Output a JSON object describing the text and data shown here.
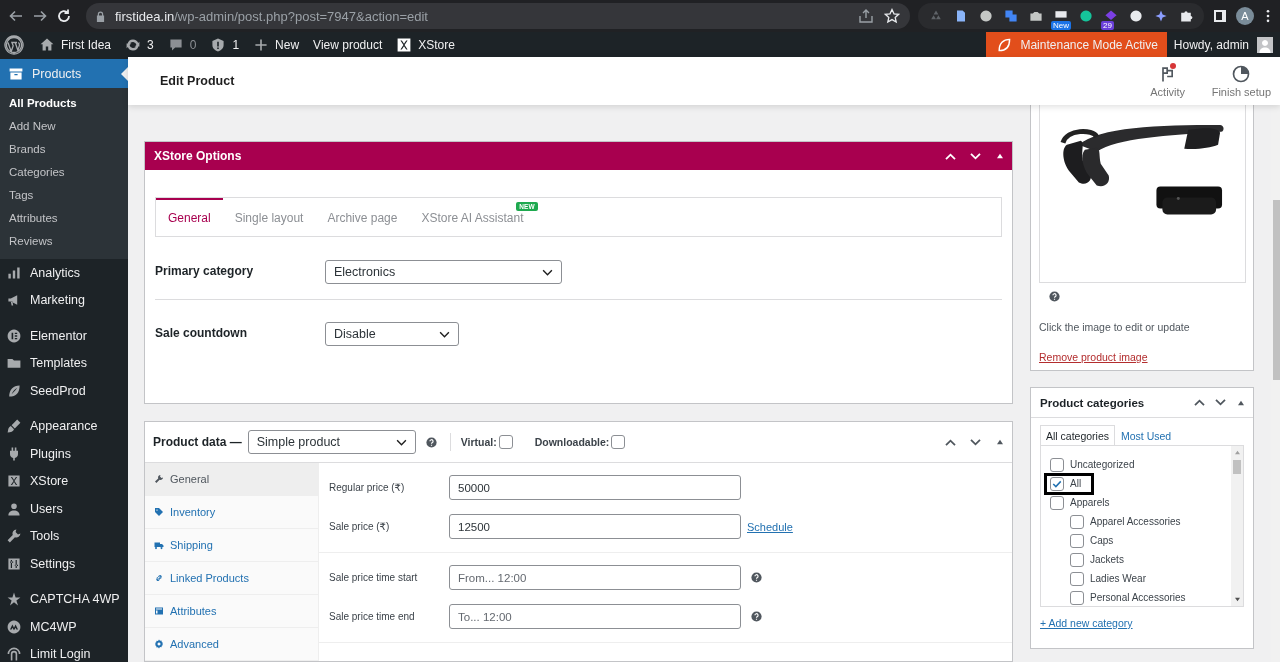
{
  "browser": {
    "url_host": "firstidea.in",
    "url_path": "/wp-admin/post.php?post=7947&action=edit",
    "extensions": [
      {
        "kind": "plain"
      },
      {
        "kind": "plain"
      },
      {
        "kind": "plain"
      },
      {
        "kind": "plain"
      },
      {
        "kind": "plain"
      },
      {
        "kind": "badge",
        "badge": "New"
      },
      {
        "kind": "plain"
      },
      {
        "kind": "badge",
        "badge": "29"
      },
      {
        "kind": "plain"
      },
      {
        "kind": "plain"
      },
      {
        "kind": "plain"
      }
    ],
    "profile": "A"
  },
  "admin_bar": {
    "site": "First Idea",
    "updates": "3",
    "comments": "0",
    "security": "1",
    "new": "New",
    "view": "View product",
    "xstore": "XStore",
    "maintenance": "Maintenance Mode Active",
    "howdy": "Howdy, admin"
  },
  "sidebar": {
    "current": "Products",
    "submenu": [
      {
        "label": "All Products",
        "selected": true
      },
      {
        "label": "Add New",
        "selected": false
      },
      {
        "label": "Brands",
        "selected": false
      },
      {
        "label": "Categories",
        "selected": false
      },
      {
        "label": "Tags",
        "selected": false
      },
      {
        "label": "Attributes",
        "selected": false
      },
      {
        "label": "Reviews",
        "selected": false
      }
    ],
    "groups": [
      [
        "Analytics",
        "Marketing"
      ],
      [
        "Elementor",
        "Templates",
        "SeedProd"
      ],
      [
        "Appearance",
        "Plugins",
        "XStore",
        "Users",
        "Tools",
        "Settings"
      ],
      [
        "CAPTCHA 4WP",
        "MC4WP",
        "Limit Login"
      ]
    ]
  },
  "header": {
    "title": "Edit Product",
    "actions": [
      {
        "label": "Activity",
        "notification": true
      },
      {
        "label": "Finish setup",
        "notification": false
      }
    ]
  },
  "xstore_options": {
    "title": "XStore Options",
    "tabs": [
      {
        "label": "General",
        "selected": true
      },
      {
        "label": "Single layout",
        "selected": false
      },
      {
        "label": "Archive page",
        "selected": false
      },
      {
        "label": "XStore AI Assistant",
        "selected": false,
        "badge": "NEW"
      }
    ],
    "fields": [
      {
        "label": "Primary category",
        "value": "Electronics"
      },
      {
        "label": "Sale countdown",
        "value": "Disable"
      }
    ]
  },
  "product_data": {
    "title": "Product data —",
    "type": "Simple product",
    "virtual": {
      "label": "Virtual:",
      "checked": false
    },
    "downloadable": {
      "label": "Downloadable:",
      "checked": false
    },
    "tabs": [
      {
        "label": "General",
        "selected": true
      },
      {
        "label": "Inventory",
        "selected": false
      },
      {
        "label": "Shipping",
        "selected": false
      },
      {
        "label": "Linked Products",
        "selected": false
      },
      {
        "label": "Attributes",
        "selected": false
      },
      {
        "label": "Advanced",
        "selected": false
      }
    ],
    "price_fields": [
      {
        "label": "Regular price (₹)",
        "value": "50000"
      },
      {
        "label": "Sale price (₹)",
        "value": "12500",
        "link": "Schedule"
      }
    ],
    "schedule_fields": [
      {
        "label": "Sale price time start",
        "placeholder": "From... 12:00"
      },
      {
        "label": "Sale price time end",
        "placeholder": "To... 12:00"
      }
    ]
  },
  "product_image": {
    "hint": "Click the image to edit or update",
    "remove": "Remove product image"
  },
  "product_categories": {
    "title": "Product categories",
    "tabs": [
      {
        "label": "All categories",
        "selected": true
      },
      {
        "label": "Most Used",
        "selected": false
      }
    ],
    "items": [
      {
        "label": "Uncategorized",
        "checked": false,
        "highlighted": false
      },
      {
        "label": "All",
        "checked": true,
        "highlighted": true
      },
      {
        "label": "Apparels",
        "checked": false,
        "highlighted": false,
        "children": [
          {
            "label": "Apparel Accessories",
            "checked": false,
            "highlighted": false
          },
          {
            "label": "Caps",
            "checked": false,
            "highlighted": false
          },
          {
            "label": "Jackets",
            "checked": false,
            "highlighted": false
          },
          {
            "label": "Ladies Wear",
            "checked": false,
            "highlighted": false
          },
          {
            "label": "Personal Accessories",
            "checked": false,
            "highlighted": false
          }
        ]
      }
    ],
    "add_new": "+ Add new category"
  }
}
